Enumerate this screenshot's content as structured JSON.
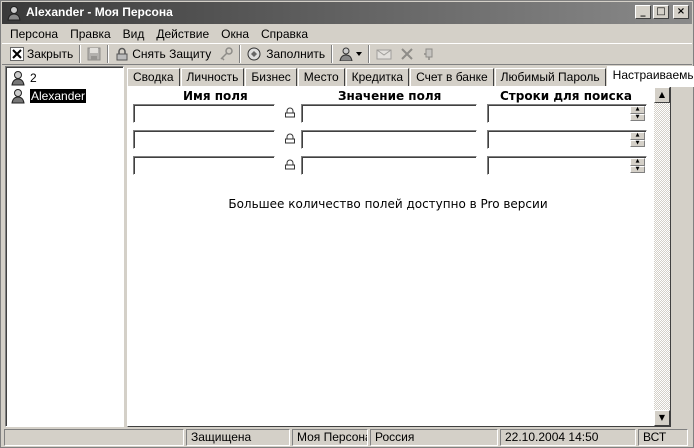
{
  "window": {
    "title": "Alexander - Моя Персона",
    "controls": {
      "minimize": "_",
      "maximize": "□",
      "close": "×"
    }
  },
  "menu": [
    "Персона",
    "Правка",
    "Вид",
    "Действие",
    "Окна",
    "Справка"
  ],
  "toolbar": {
    "close_label": "Закрыть",
    "unprotect_label": "Снять Защиту",
    "fill_label": "Заполнить"
  },
  "tree": {
    "items": [
      {
        "label": "2",
        "selected": false
      },
      {
        "label": "Alexander",
        "selected": true
      }
    ]
  },
  "tabs": [
    {
      "label": "Сводка",
      "active": false
    },
    {
      "label": "Личность",
      "active": false
    },
    {
      "label": "Бизнес",
      "active": false
    },
    {
      "label": "Место",
      "active": false
    },
    {
      "label": "Кредитка",
      "active": false
    },
    {
      "label": "Счет в банке",
      "active": false
    },
    {
      "label": "Любимый Пароль",
      "active": false
    },
    {
      "label": "Настраиваемые",
      "active": true
    }
  ],
  "custom_fields": {
    "col_name": "Имя поля",
    "col_value": "Значение поля",
    "col_search": "Строки для поиска",
    "rows": [
      {
        "name": "",
        "value": "",
        "search": ""
      },
      {
        "name": "",
        "value": "",
        "search": ""
      },
      {
        "name": "",
        "value": "",
        "search": ""
      }
    ],
    "pro_note": "Большее количество полей доступно в Pro версии"
  },
  "status": {
    "protection": "Защищена",
    "persona": "Моя Персона",
    "country": "Россия",
    "datetime": "22.10.2004 14:50",
    "weekday": "ВСТ"
  },
  "colors": {
    "title_gradient_start": "#3a3a3a",
    "title_gradient_end": "#8a8a8a",
    "face": "#d4d0c8"
  }
}
